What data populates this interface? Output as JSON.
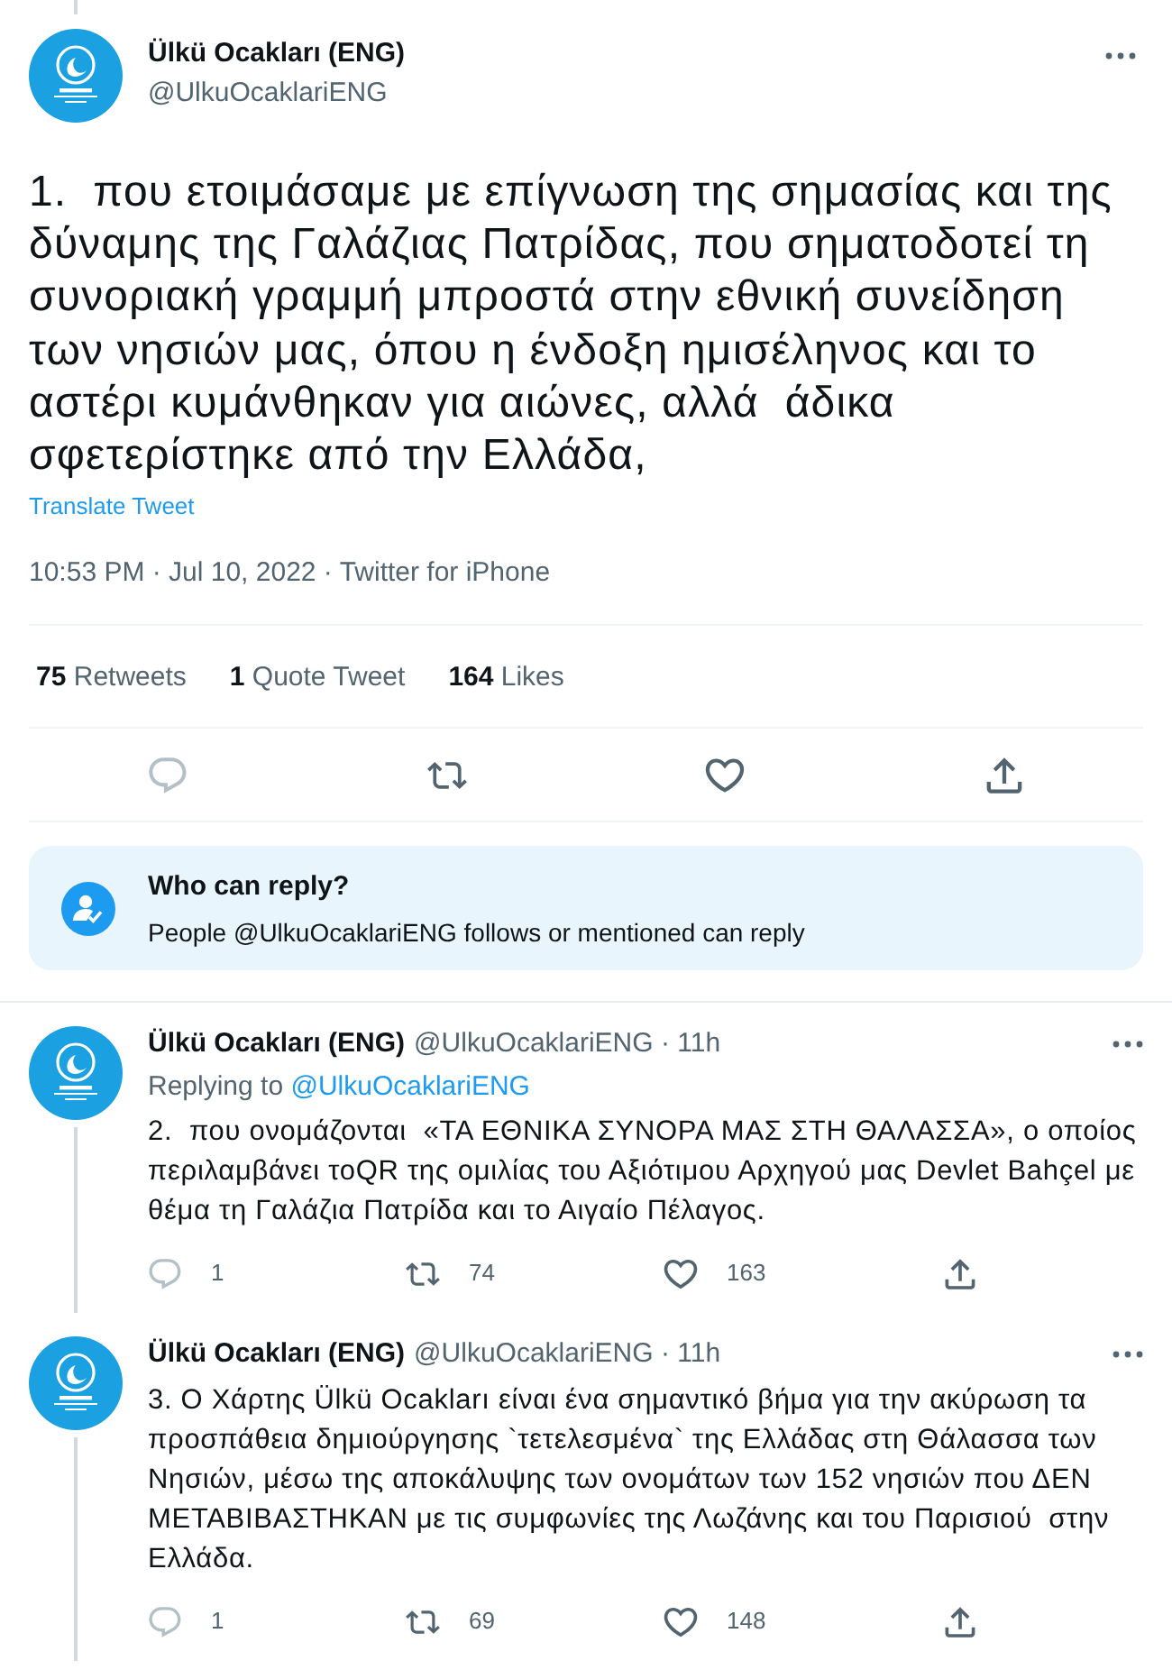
{
  "main_tweet": {
    "author": {
      "name": "Ülkü Ocakları (ENG)",
      "handle": "@UlkuOcaklariENG"
    },
    "text": "1.  που ετοιμάσαμε με επίγνωση της σημασίας και της δύναμης της Γαλάζιας Πατρίδας, που σηματοδοτεί τη συνοριακή γραμμή μπροστά στην εθνική συνείδηση των νησιών μας, όπου η ένδοξη ημισέληνος και το αστέρι κυμάνθηκαν για αιώνες, αλλά  άδικα σφετερίστηκε από την Ελλάδα,",
    "translate": "Translate Tweet",
    "meta": "10:53 PM · Jul 10, 2022 · Twitter for iPhone",
    "stats": [
      {
        "count": "75",
        "label": "Retweets"
      },
      {
        "count": "1",
        "label": "Quote Tweet"
      },
      {
        "count": "164",
        "label": "Likes"
      }
    ],
    "actions": [
      {
        "kind": "reply",
        "disabled": true
      },
      {
        "kind": "retweet",
        "disabled": false
      },
      {
        "kind": "like",
        "disabled": false
      },
      {
        "kind": "share",
        "disabled": false
      }
    ],
    "reply_settings": {
      "title": "Who can reply?",
      "text": "People @UlkuOcaklariENG follows or mentioned can reply"
    }
  },
  "replies": [
    {
      "name": "Ülkü Ocakları (ENG)",
      "handle_line": "@UlkuOcaklariENG · 11h",
      "replying_to": {
        "label": "Replying to",
        "handle": "@UlkuOcaklariENG"
      },
      "text": "2.  που ονομάζονται  «ΤΑ ΕΘΝΙΚΑ ΣΥΝΟΡΑ ΜΑΣ ΣΤΗ ΘΑΛΑΣΣΑ», ο οποίος περιλαμβάνει τοQR της ομιλίας του Αξιότιμου Αρχηγού μας Devlet Bahçel με θέμα τη Γαλάζια Πατρίδα και το Αιγαίο Πέλαγος.",
      "actions": [
        {
          "kind": "reply",
          "count": "1",
          "disabled": true
        },
        {
          "kind": "retweet",
          "count": "74",
          "disabled": false
        },
        {
          "kind": "like",
          "count": "163",
          "disabled": false
        },
        {
          "kind": "share",
          "disabled": false
        }
      ]
    },
    {
      "name": "Ülkü Ocakları (ENG)",
      "handle_line": "@UlkuOcaklariENG · 11h",
      "text": "3. Ο Χάρτης Ülkü Ocakları είναι ένα σημαντικό βήμα για την ακύρωση τα προσπάθεια δημιούργησης `τετελεσμένα` της Ελλάδας στη Θάλασσα των Νησιών, μέσω της αποκάλυψης των ονομάτων των 152 νησιών που ΔΕΝ ΜΕΤΑΒΙΒΑΣΤΗΚΑΝ με τις συμφωνίες της Λωζάνης και του Παρισιού  στην Ελλάδα.",
      "actions": [
        {
          "kind": "reply",
          "count": "1",
          "disabled": true
        },
        {
          "kind": "retweet",
          "count": "69",
          "disabled": false
        },
        {
          "kind": "like",
          "count": "148",
          "disabled": false
        },
        {
          "kind": "share",
          "disabled": false
        }
      ]
    }
  ]
}
